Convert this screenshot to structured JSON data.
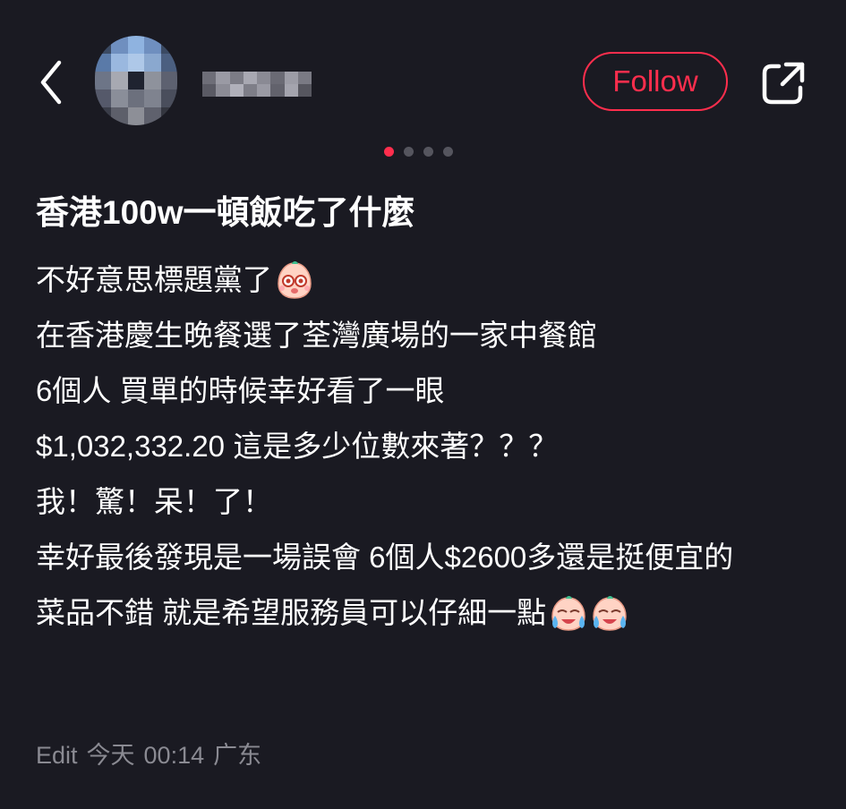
{
  "header": {
    "back_icon": "chevron-left-icon",
    "follow_label": "Follow",
    "share_icon": "share-out-icon",
    "accent_color": "#ff2e4d",
    "carousel": {
      "total": 4,
      "active_index": 1
    }
  },
  "post": {
    "title": "香港100w一頓飯吃了什麼",
    "lines": {
      "l1": "不好意思標題黨了",
      "l2": "在香港慶生晚餐選了荃灣廣場的一家中餐館",
      "l3": "6個人 買單的時候幸好看了一眼",
      "l4": "$1,032,332.20 這是多少位數來著？？？",
      "l5": "我！驚！呆！了！",
      "l6": "幸好最後發現是一場誤會 6個人$2600多還是挺便宜的",
      "l7": "菜品不錯 就是希望服務員可以仔細一點"
    },
    "emojis": {
      "after_l1": "shocked-face-emoji",
      "after_l7": "crying-face-emoji"
    },
    "meta": {
      "edit": "Edit",
      "date": "今天",
      "time": "00:14",
      "location": "广东"
    }
  }
}
